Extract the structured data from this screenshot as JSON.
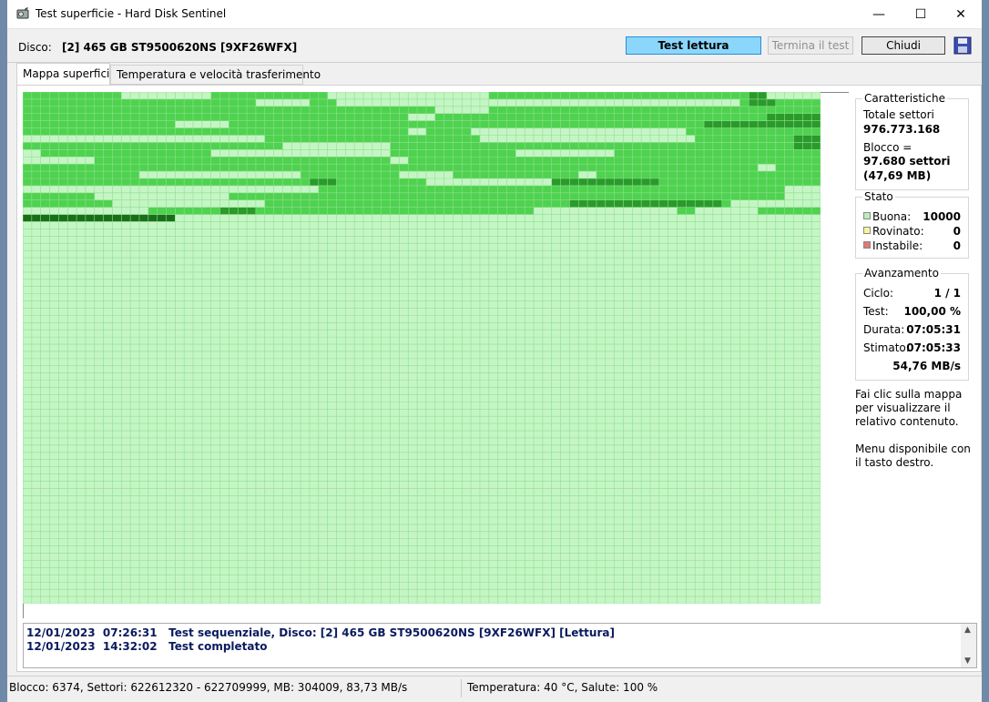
{
  "window": {
    "title": "Test superficie - Hard Disk Sentinel",
    "minimize": "—",
    "maximize": "☐",
    "close": "✕"
  },
  "toolbar": {
    "disk_label": "Disco:",
    "disk_value": "[2] 465 GB  ST9500620NS [9XF26WFX]",
    "test_button": "Test lettura",
    "stop_button": "Termina il test",
    "close_button": "Chiudi"
  },
  "tabs": [
    {
      "label": "Mappa superficie",
      "active": true
    },
    {
      "label": "Temperatura e velocità trasferimento",
      "active": false
    }
  ],
  "map": {
    "columns": 89,
    "rows": 71,
    "processed_rows": 18,
    "colors": {
      "good": "#c5f5c5",
      "grid": "#8ee08e",
      "mid": "#4fd24f",
      "dark": "#2a9a2a",
      "darkest": "#1a6e1a"
    }
  },
  "characteristics": {
    "title": "Caratteristiche",
    "total_label": "Totale settori",
    "total_value": "976.773.168",
    "block_label": "Blocco =",
    "block_value": "97.680 settori",
    "block_size": "(47,69 MB)"
  },
  "state": {
    "title": "Stato",
    "items": [
      {
        "label": "Buona:",
        "value": "10000",
        "color": "#b8efb8"
      },
      {
        "label": "Rovinato:",
        "value": "0",
        "color": "#f5f5a0"
      },
      {
        "label": "Instabile:",
        "value": "0",
        "color": "#e07878"
      }
    ]
  },
  "progress": {
    "title": "Avanzamento",
    "items": [
      {
        "label": "Ciclo:",
        "value": "1 / 1"
      },
      {
        "label": "Test:",
        "value": "100,00 %"
      },
      {
        "label": "Durata:",
        "value": "07:05:31"
      },
      {
        "label": "Stimato:",
        "value": "07:05:33"
      }
    ],
    "speed": "54,76 MB/s"
  },
  "notes": {
    "click": "Fai clic sulla mappa per visualizzare il relativo contenuto.",
    "menu": "Menu disponibile con il tasto destro."
  },
  "log": [
    {
      "date": "12/01/2023",
      "time": "07:26:31",
      "text": "Test sequenziale, Disco: [2] 465 GB  ST9500620NS [9XF26WFX] [Lettura]"
    },
    {
      "date": "12/01/2023",
      "time": "14:32:02",
      "text": "Test completato"
    }
  ],
  "status": {
    "left": "Blocco: 6374, Settori: 622612320 - 622709999, MB: 304009, 83,73 MB/s",
    "right": "Temperatura: 40  °C,  Salute: 100 %"
  }
}
